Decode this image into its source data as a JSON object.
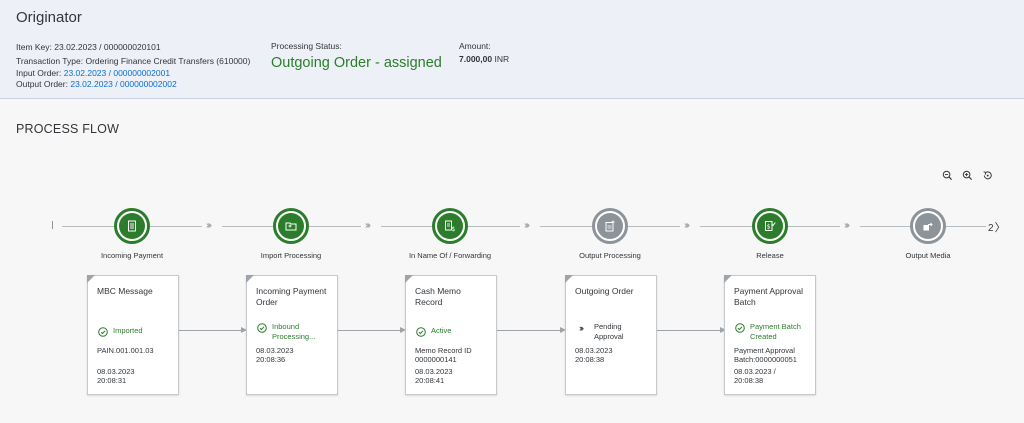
{
  "header": {
    "title": "Originator",
    "item_key": "Item Key: 23.02.2023 / 000000020101",
    "transaction_type": "Transaction Type: Ordering Finance Credit Transfers (610000)",
    "input_order_label": "Input Order: ",
    "input_order_link": "23.02.2023 / 000000002001",
    "output_order_label": "Output Order: ",
    "output_order_link": "23.02.2023 / 000000002002",
    "status_label": "Processing Status:",
    "status_value": "Outgoing Order - assigned",
    "amount_label": "Amount:",
    "amount_value": "7.000,00",
    "amount_currency": "INR"
  },
  "section_title": "PROCESS FLOW",
  "colors": {
    "success": "#2b7d2b",
    "neutral": "#8c9399",
    "link": "#0a6ed1"
  },
  "zoom_icons": [
    "zoom-in-icon",
    "zoom-out-icon",
    "reset-zoom-icon"
  ],
  "lanes": [
    {
      "label": "Incoming Payment",
      "icon": "document-list-icon",
      "state": "success"
    },
    {
      "label": "Import Processing",
      "icon": "folder-open-icon",
      "state": "success"
    },
    {
      "label": "In Name Of / Forwarding",
      "icon": "money-document-icon",
      "state": "success"
    },
    {
      "label": "Output Processing",
      "icon": "document-add-icon",
      "state": "neutral"
    },
    {
      "label": "Release",
      "icon": "approval-icon",
      "state": "success"
    },
    {
      "label": "Output Media",
      "icon": "export-icon",
      "state": "neutral"
    }
  ],
  "end_marker": "2",
  "nodes": [
    {
      "title": "MBC Message",
      "status": "Imported",
      "status_type": "success",
      "details": [
        "PAIN.001.001.03",
        "",
        "08.03.2023",
        "20:08:31"
      ]
    },
    {
      "title": "Incoming Payment Order",
      "status": "Inbound Processing...",
      "status_type": "success",
      "details": [
        "08.03.2023",
        "20:08:36"
      ]
    },
    {
      "title": "Cash Memo Record",
      "status": "Active",
      "status_type": "success",
      "details": [
        "Memo Record ID",
        "0000000141",
        "08.03.2023",
        "20:08:41"
      ]
    },
    {
      "title": "Outgoing Order",
      "status": "Pending Approval",
      "status_type": "pending",
      "details": [
        "08.03.2023",
        "20:08:38"
      ]
    },
    {
      "title": "Payment Approval Batch",
      "status": "Payment Batch Created",
      "status_type": "success",
      "details": [
        "Payment Approval",
        "Batch:0000000051",
        "08.03.2023 /",
        "20:08:38"
      ]
    }
  ]
}
